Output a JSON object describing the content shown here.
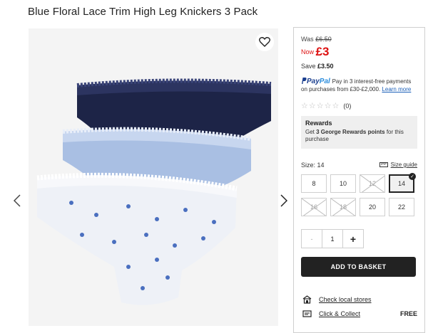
{
  "product": {
    "title": "Blue Floral Lace Trim High Leg Knickers 3 Pack"
  },
  "gallery": {
    "wishlist_icon": "heart-icon",
    "prev_icon": "chevron-left-icon",
    "next_icon": "chevron-right-icon"
  },
  "price": {
    "was_label": "Was",
    "was_value": "£6.50",
    "now_label": "Now",
    "now_value": "£3",
    "save_label": "Save",
    "save_value": "£3.50",
    "color_red": "#dd1111"
  },
  "paypal": {
    "logo_pay": "Pay",
    "logo_pal": "Pal",
    "text": "Pay in 3 interest-free payments on purchases from £30-£2,000.",
    "learn_more": "Learn more"
  },
  "reviews": {
    "count": "(0)",
    "rating": 0,
    "max": 5
  },
  "rewards": {
    "title": "Rewards",
    "text_pre": "Get ",
    "text_bold": "3 George Rewards points",
    "text_post": " for this purchase"
  },
  "size": {
    "label": "Size:",
    "selected": "14",
    "guide": "Size guide",
    "options": [
      {
        "label": "8",
        "available": true
      },
      {
        "label": "10",
        "available": true
      },
      {
        "label": "12",
        "available": false
      },
      {
        "label": "14",
        "available": true,
        "selected": true
      },
      {
        "label": "16",
        "available": false
      },
      {
        "label": "18",
        "available": false
      },
      {
        "label": "20",
        "available": true
      },
      {
        "label": "22",
        "available": true
      }
    ]
  },
  "quantity": {
    "minus": "-",
    "value": "1",
    "plus": "+"
  },
  "basket": {
    "label": "ADD TO BASKET"
  },
  "delivery": {
    "check_stores": "Check local stores",
    "click_collect": "Click & Collect",
    "click_collect_price": "FREE"
  }
}
